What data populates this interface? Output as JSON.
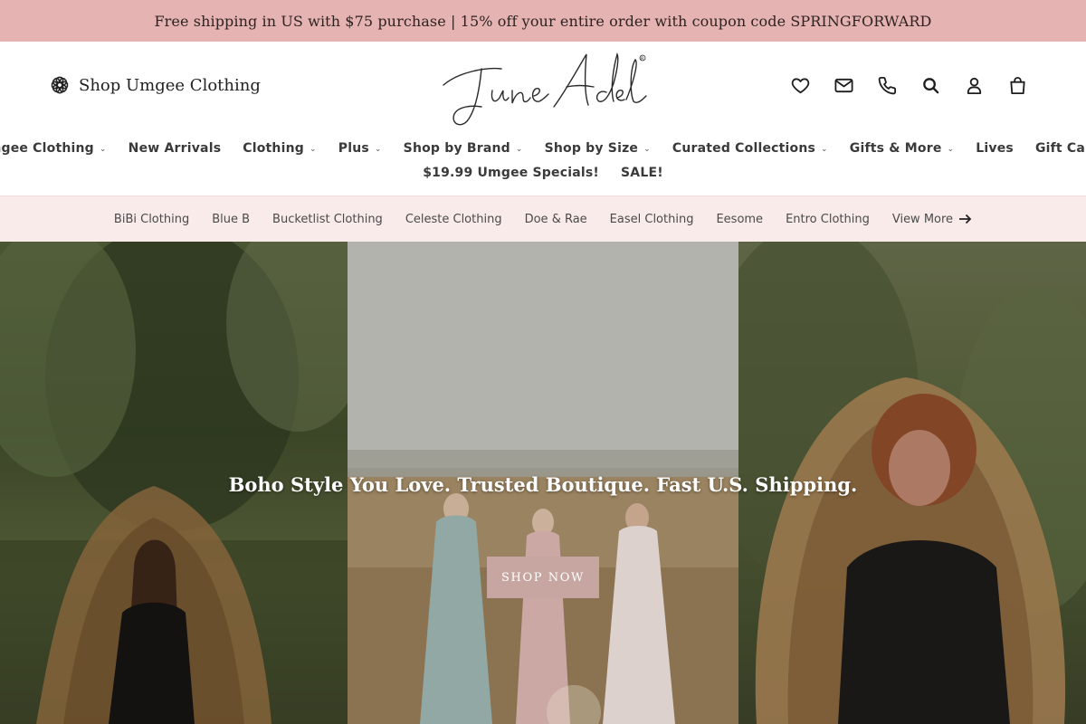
{
  "announcement": {
    "text": "Free shipping in US with $75 purchase | 15% off your entire order with coupon code SPRINGFORWARD",
    "background": "#e5b3b2"
  },
  "header": {
    "shop_link_label": "Shop Umgee Clothing",
    "shop_link_icon": "flower-icon",
    "logo_text": "June Adel",
    "logo_mark": "®",
    "icons": [
      "heart-icon",
      "mail-icon",
      "phone-icon",
      "search-icon",
      "account-icon",
      "cart-icon"
    ]
  },
  "nav": {
    "row1": [
      {
        "label": "Umgee Clothing",
        "dropdown": true
      },
      {
        "label": "New Arrivals",
        "dropdown": false
      },
      {
        "label": "Clothing",
        "dropdown": true
      },
      {
        "label": "Plus",
        "dropdown": true
      },
      {
        "label": "Shop by Brand",
        "dropdown": true
      },
      {
        "label": "Shop by Size",
        "dropdown": true
      },
      {
        "label": "Curated Collections",
        "dropdown": true
      },
      {
        "label": "Gifts & More",
        "dropdown": true
      },
      {
        "label": "Lives",
        "dropdown": false
      },
      {
        "label": "Gift Cards",
        "dropdown": false
      }
    ],
    "row2": [
      {
        "label": "$19.99 Umgee Specials!",
        "dropdown": false
      },
      {
        "label": "SALE!",
        "dropdown": false
      }
    ],
    "chevron": "⌄"
  },
  "brands": {
    "items": [
      "BiBi Clothing",
      "Blue B",
      "Bucketlist Clothing",
      "Celeste Clothing",
      "Doe & Rae",
      "Easel Clothing",
      "Eesome",
      "Entro Clothing"
    ],
    "view_more": "View More",
    "background": "#f9ebe9"
  },
  "hero": {
    "title": "Boho Style You Love. Trusted Boutique. Fast U.S. Shipping.",
    "button_label": "SHOP NOW",
    "button_color": "#c7a6a1"
  }
}
